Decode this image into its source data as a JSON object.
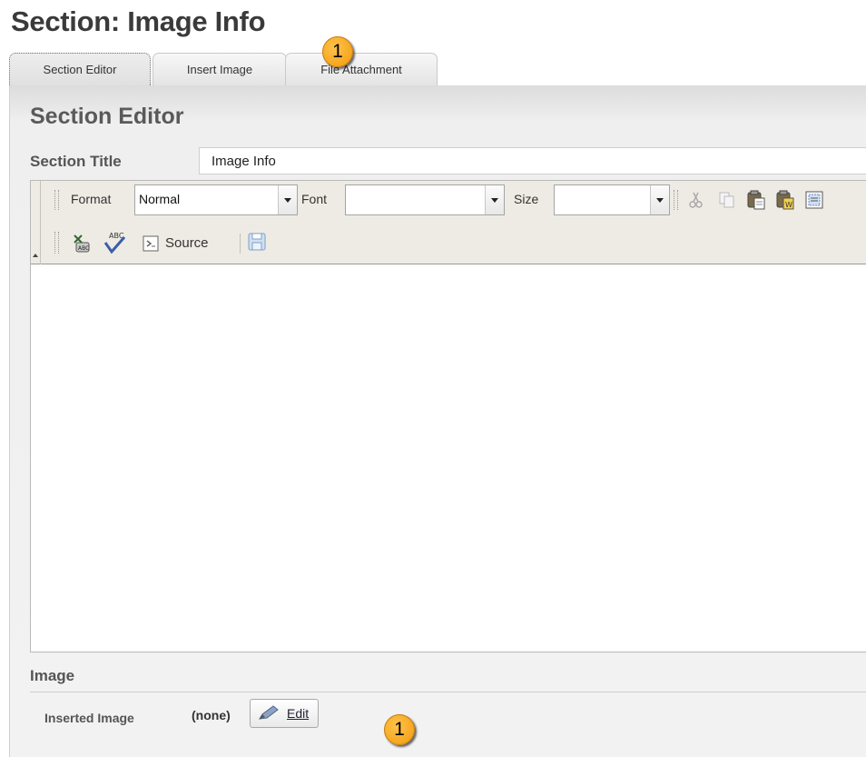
{
  "page": {
    "title": "Section: Image Info"
  },
  "tabs": [
    {
      "label": "Section Editor",
      "active": true
    },
    {
      "label": "Insert Image",
      "active": false
    },
    {
      "label": "File Attachment",
      "active": false
    }
  ],
  "panel": {
    "heading": "Section Editor",
    "section_title": {
      "label": "Section Title",
      "value": "Image Info"
    }
  },
  "toolbar": {
    "format": {
      "label": "Format",
      "value": "Normal"
    },
    "font": {
      "label": "Font",
      "value": ""
    },
    "size": {
      "label": "Size",
      "value": ""
    },
    "row1_icons": [
      "cut-icon",
      "copy-icon",
      "paste-icon",
      "paste-from-word-icon",
      "select-all-icon"
    ],
    "row2_icons": [
      "spell-check-icon",
      "spell-check-abc-icon",
      "source-icon",
      "save-icon"
    ],
    "source_label": "Source"
  },
  "image_section": {
    "heading": "Image",
    "inserted_label": "Inserted Image",
    "inserted_value": "(none)",
    "edit_label": "Edit"
  },
  "badges": {
    "top": "1",
    "bottom": "1"
  },
  "colors": {
    "badge": "#f5a623",
    "toolbar_bg": "#eeebe4",
    "panel_bg": "#f2f2f2"
  }
}
